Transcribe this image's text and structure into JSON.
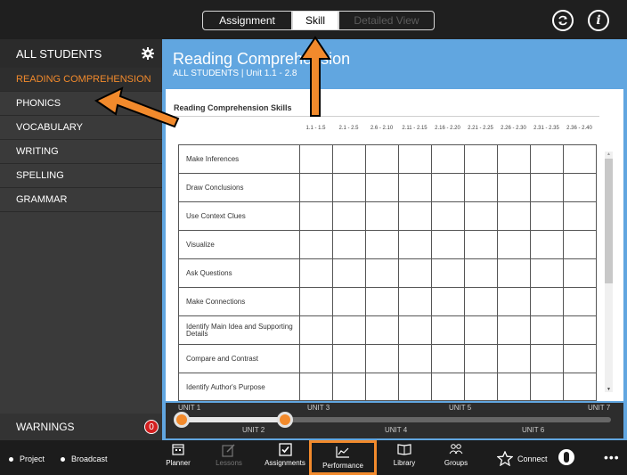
{
  "topbar": {
    "tabs": [
      {
        "label": "Assignment",
        "state": "inactive"
      },
      {
        "label": "Skill",
        "state": "active"
      },
      {
        "label": "Detailed View",
        "state": "disabled"
      }
    ],
    "icons": [
      "refresh-icon",
      "info-icon"
    ]
  },
  "sidebar": {
    "header": "ALL STUDENTS",
    "header_icon": "gear-icon",
    "items": [
      {
        "label": "READING COMPREHENSION",
        "active": true
      },
      {
        "label": "PHONICS",
        "active": false
      },
      {
        "label": "VOCABULARY",
        "active": false
      },
      {
        "label": "WRITING",
        "active": false
      },
      {
        "label": "SPELLING",
        "active": false
      },
      {
        "label": "GRAMMAR",
        "active": false
      }
    ],
    "warnings": {
      "label": "WARNINGS",
      "count": "0"
    }
  },
  "main": {
    "title": "Reading Comprehension",
    "subtitle": "ALL STUDENTS | Unit 1.1 - 2.8",
    "card_title": "Reading Comprehension Skills",
    "columns": [
      "1.1 - 1.5",
      "2.1 - 2.5",
      "2.6 - 2.10",
      "2.11 - 2.15",
      "2.16 - 2.20",
      "2.21 - 2.25",
      "2.26 - 2.30",
      "2.31 - 2.35",
      "2.36 - 2.40"
    ],
    "skills": [
      "Make Inferences",
      "Draw Conclusions",
      "Use Context Clues",
      "Visualize",
      "Ask Questions",
      "Make Connections",
      "Identify Main Idea and Supporting Details",
      "Compare and Contrast",
      "Identify Author's Purpose"
    ],
    "units": {
      "top_labels": [
        "UNIT 1",
        "UNIT 3",
        "UNIT 5",
        "UNIT 7"
      ],
      "bottom_labels": [
        "UNIT 2",
        "UNIT 4",
        "UNIT 6"
      ],
      "range_fraction": [
        0.0,
        0.24
      ]
    }
  },
  "bottombar": {
    "left": [
      {
        "label": "Project"
      },
      {
        "label": "Broadcast"
      }
    ],
    "nav": [
      {
        "label": "Planner",
        "icon": "calendar-icon",
        "dim": false
      },
      {
        "label": "Lessons",
        "icon": "edit-icon",
        "dim": true
      },
      {
        "label": "Assignments",
        "icon": "checkbox-icon",
        "dim": false
      },
      {
        "label": "Performance",
        "icon": "chart-icon",
        "dim": false,
        "highlighted": true
      },
      {
        "label": "Library",
        "icon": "book-icon",
        "dim": false
      },
      {
        "label": "Groups",
        "icon": "groups-icon",
        "dim": false
      }
    ],
    "connect": "Connect",
    "colors": {
      "accent": "#f28a2c",
      "header_blue": "#61a6e0"
    }
  }
}
